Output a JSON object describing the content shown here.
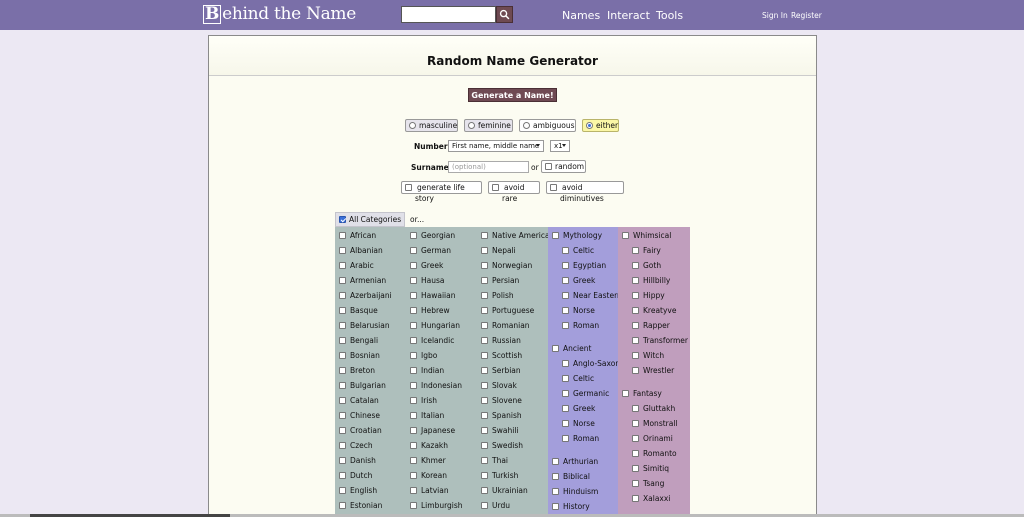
{
  "site": {
    "logo_letter": "B",
    "logo_rest": "ehind the Name"
  },
  "header": {
    "nav": [
      "Names",
      "Interact",
      "Tools"
    ],
    "signin": "Sign In",
    "register": "Register"
  },
  "page": {
    "title": "Random Name Generator",
    "generate_label": "Generate a Name!"
  },
  "gender": {
    "masculine": "masculine",
    "feminine": "feminine",
    "ambiguous": "ambiguous",
    "either": "either",
    "selected": "either"
  },
  "number": {
    "label": "Number",
    "value": "First name, middle name",
    "multiplier": "x1"
  },
  "surname": {
    "label": "Surname",
    "placeholder": "(optional)",
    "or": "or",
    "random": "random"
  },
  "options": {
    "life_story": "generate life story",
    "avoid_rare": "avoid rare",
    "avoid_diminutives": "avoid diminutives"
  },
  "categories": {
    "all_label": "All Categories",
    "or": "or...",
    "col1": [
      "African",
      "Albanian",
      "Arabic",
      "Armenian",
      "Azerbaijani",
      "Basque",
      "Belarusian",
      "Bengali",
      "Bosnian",
      "Breton",
      "Bulgarian",
      "Catalan",
      "Chinese",
      "Croatian",
      "Czech",
      "Danish",
      "Dutch",
      "English",
      "Estonian"
    ],
    "col2": [
      "Georgian",
      "German",
      "Greek",
      "Hausa",
      "Hawaiian",
      "Hebrew",
      "Hungarian",
      "Icelandic",
      "Igbo",
      "Indian",
      "Indonesian",
      "Irish",
      "Italian",
      "Japanese",
      "Kazakh",
      "Khmer",
      "Korean",
      "Latvian",
      "Limburgish"
    ],
    "col3": [
      "Native American",
      "Nepali",
      "Norwegian",
      "Persian",
      "Polish",
      "Portuguese",
      "Romanian",
      "Russian",
      "Scottish",
      "Serbian",
      "Slovak",
      "Slovene",
      "Spanish",
      "Swahili",
      "Swedish",
      "Thai",
      "Turkish",
      "Ukrainian",
      "Urdu"
    ],
    "mythology": {
      "label": "Mythology",
      "items": [
        "Celtic",
        "Egyptian",
        "Greek",
        "Near Eastern",
        "Norse",
        "Roman"
      ]
    },
    "ancient": {
      "label": "Ancient",
      "items": [
        "Anglo-Saxon",
        "Celtic",
        "Germanic",
        "Greek",
        "Norse",
        "Roman"
      ]
    },
    "col4_more": [
      "Arthurian",
      "Biblical",
      "Hinduism",
      "History"
    ],
    "whimsical": {
      "label": "Whimsical",
      "items": [
        "Fairy",
        "Goth",
        "Hillbilly",
        "Hippy",
        "Kreatyve",
        "Rapper",
        "Transformer",
        "Witch",
        "Wrestler"
      ]
    },
    "fantasy": {
      "label": "Fantasy",
      "items": [
        "Gluttakh",
        "Monstrall",
        "Orinami",
        "Romanto",
        "Simitiq",
        "Tsang",
        "Xalaxxi"
      ]
    }
  }
}
